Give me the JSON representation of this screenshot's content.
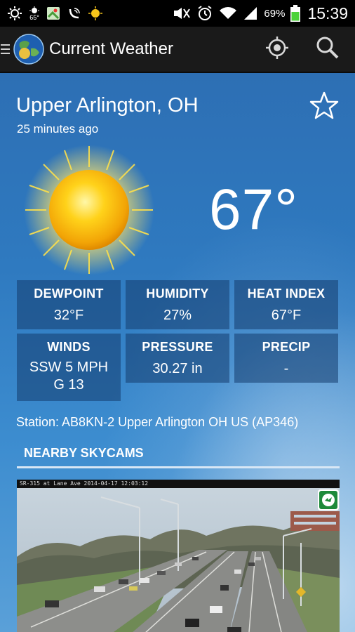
{
  "status_bar": {
    "notif_temp": "65°",
    "battery_percent": "69%",
    "clock": "15:39"
  },
  "action_bar": {
    "title": "Current Weather"
  },
  "weather": {
    "location": "Upper Arlington, OH",
    "updated": "25 minutes ago",
    "temperature": "67°",
    "condition_icon": "sun-icon"
  },
  "details": [
    {
      "label": "DEWPOINT",
      "value": "32°F"
    },
    {
      "label": "HUMIDITY",
      "value": "27%"
    },
    {
      "label": "HEAT INDEX",
      "value": "67°F"
    },
    {
      "label": "WINDS",
      "value": "SSW 5 MPH\nG 13",
      "line1": "SSW 5 MPH",
      "line2": "G 13"
    },
    {
      "label": "PRESSURE",
      "value": "30.27 in"
    },
    {
      "label": "PRECIP",
      "value": "-"
    }
  ],
  "station": "Station: AB8KN-2 Upper Arlington OH US (AP346)",
  "skycams": {
    "header": "NEARBY SKYCAMS",
    "caption": "SR-315 at Lane Ave 2014-04-17 12:03:12"
  },
  "colors": {
    "sky_top": "#2d6fb4",
    "sky_bottom": "#5aa0d8",
    "card_bg": "rgba(20,60,110,0.55)",
    "battery_green": "#4cd23a"
  }
}
